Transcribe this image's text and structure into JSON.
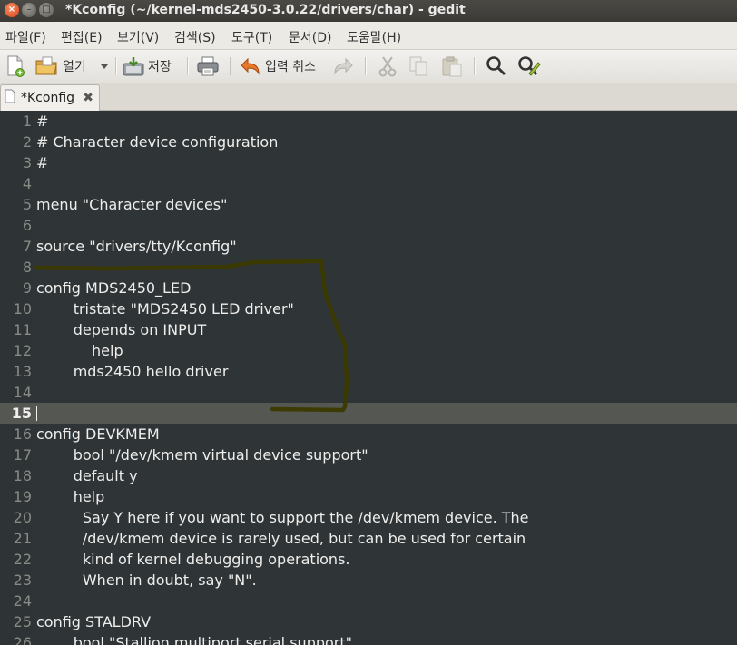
{
  "window": {
    "title": "*Kconfig (~/kernel-mds2450-3.0.22/drivers/char) - gedit",
    "controls": {
      "close": "×",
      "minimize": "–",
      "maximize": "□"
    }
  },
  "menubar": {
    "items": [
      "파일(F)",
      "편집(E)",
      "보기(V)",
      "검색(S)",
      "도구(T)",
      "문서(D)",
      "도움말(H)"
    ]
  },
  "toolbar": {
    "open_label": "열기",
    "save_label": "저장",
    "undo_label": "입력 취소",
    "icons": [
      "new-document-icon",
      "open-folder-icon",
      "dropdown-arrow-icon",
      "save-icon",
      "print-icon",
      "undo-icon",
      "redo-icon",
      "cut-icon",
      "copy-icon",
      "paste-icon",
      "search-icon",
      "find-replace-icon"
    ]
  },
  "tabs": [
    {
      "label": "*Kconfig",
      "close": "✖",
      "active": true
    }
  ],
  "editor": {
    "current_line": 15,
    "annotation_color": "#3b3a00",
    "lines": [
      {
        "n": "1",
        "text": "#"
      },
      {
        "n": "2",
        "text": "# Character device configuration"
      },
      {
        "n": "3",
        "text": "#"
      },
      {
        "n": "4",
        "text": ""
      },
      {
        "n": "5",
        "text": "menu \"Character devices\""
      },
      {
        "n": "6",
        "text": ""
      },
      {
        "n": "7",
        "text": "source \"drivers/tty/Kconfig\""
      },
      {
        "n": "8",
        "text": ""
      },
      {
        "n": "9",
        "text": "config MDS2450_LED"
      },
      {
        "n": "10",
        "text": "        tristate \"MDS2450 LED driver\""
      },
      {
        "n": "11",
        "text": "        depends on INPUT"
      },
      {
        "n": "12",
        "text": "            help"
      },
      {
        "n": "13",
        "text": "        mds2450 hello driver"
      },
      {
        "n": "14",
        "text": ""
      },
      {
        "n": "15",
        "text": ""
      },
      {
        "n": "16",
        "text": "config DEVKMEM"
      },
      {
        "n": "17",
        "text": "        bool \"/dev/kmem virtual device support\""
      },
      {
        "n": "18",
        "text": "        default y"
      },
      {
        "n": "19",
        "text": "        help"
      },
      {
        "n": "20",
        "text": "          Say Y here if you want to support the /dev/kmem device. The"
      },
      {
        "n": "21",
        "text": "          /dev/kmem device is rarely used, but can be used for certain"
      },
      {
        "n": "22",
        "text": "          kind of kernel debugging operations."
      },
      {
        "n": "23",
        "text": "          When in doubt, say \"N\"."
      },
      {
        "n": "24",
        "text": ""
      },
      {
        "n": "25",
        "text": "config STALDRV"
      },
      {
        "n": "26",
        "text": "        bool \"Stallion multiport serial support\""
      }
    ]
  }
}
